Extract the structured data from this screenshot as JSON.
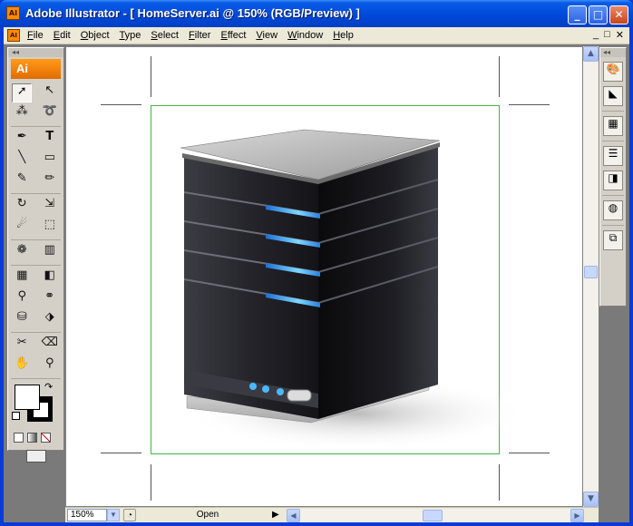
{
  "window": {
    "title": "Adobe Illustrator - [ HomeServer.ai @ 150% (RGB/Preview) ]",
    "app_icon_text": "AI",
    "controls": {
      "minimize": "_",
      "maximize": "□",
      "close": "✕"
    }
  },
  "menubar": {
    "items": [
      "File",
      "Edit",
      "Object",
      "Type",
      "Select",
      "Filter",
      "Effect",
      "View",
      "Window",
      "Help"
    ],
    "doc_controls": {
      "minimize": "_",
      "restore": "□",
      "close": "✕"
    }
  },
  "tools": {
    "logo": "Ai",
    "selected_tool": "selection"
  },
  "status": {
    "zoom": "150%",
    "text": "Open"
  },
  "colors": {
    "titlebar": "#0049d9",
    "artboard_border": "#3cb83c",
    "ai_orange": "#ff8a00",
    "server_blue": "#3bb4ff"
  }
}
